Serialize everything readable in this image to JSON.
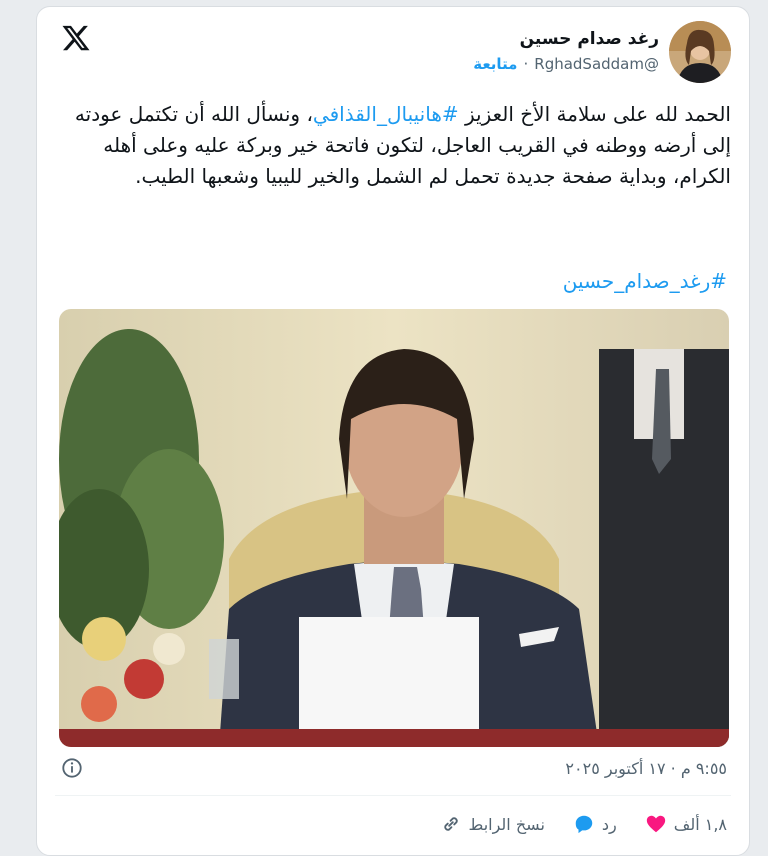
{
  "header": {
    "display_name": "رغد صدام حسين",
    "handle": "@RghadSaddam",
    "separator": "·",
    "follow_label": "متابعة"
  },
  "tweet": {
    "text_part1": "الحمد لله على سلامة الأخ العزيز ",
    "hashtag1": "#هانيبال_القذافي",
    "text_part2": "، ونسأل الله أن تكتمل عودته إلى أرضه ووطنه في القريب العاجل، لتكون فاتحة خير وبركة عليه وعلى أهله الكرام، وبداية صفحة جديدة تحمل لم الشمل والخير لليبيا وشعبها الطيب.",
    "hashtag2": "#رغد_صدام_حسين"
  },
  "meta": {
    "timestamp": "٩:٥٥ م · ١٧ أكتوبر ٢٠٢٥"
  },
  "actions": {
    "likes_count": "١,٨ ألف",
    "reply_label": "رد",
    "copy_link_label": "نسخ الرابط"
  },
  "colors": {
    "accent": "#1d9bf0",
    "like": "#f91880",
    "text": "#0f1419",
    "muted": "#536471"
  }
}
